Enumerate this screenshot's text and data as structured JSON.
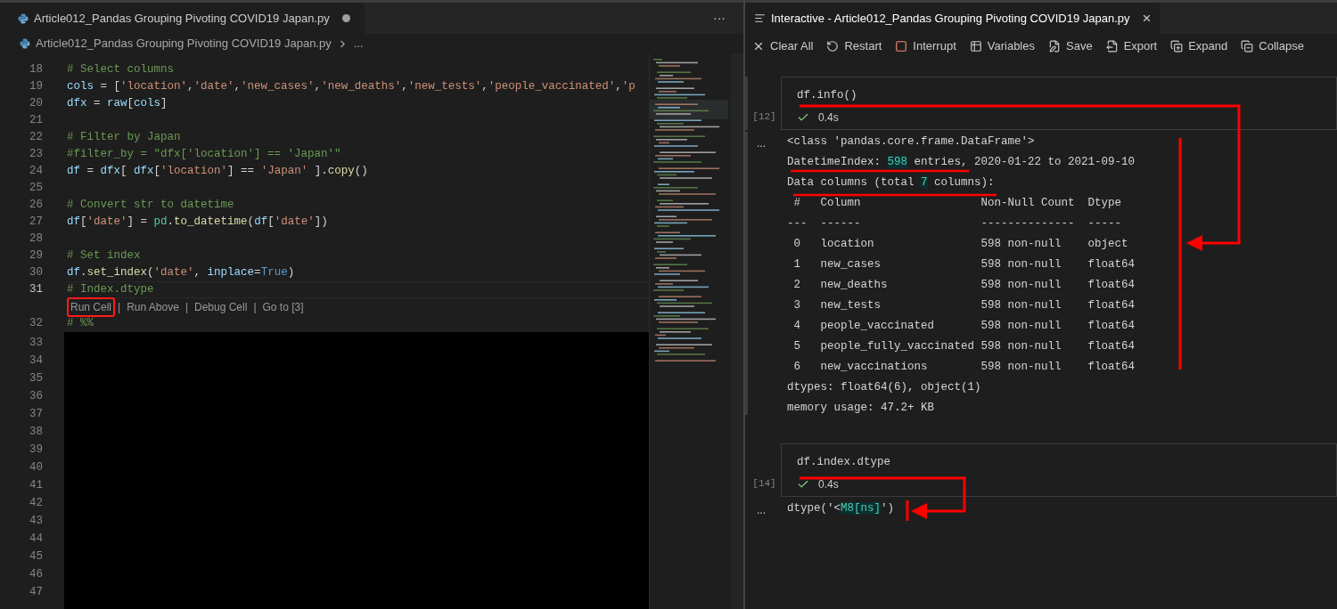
{
  "editor": {
    "tab": {
      "title": "Article012_Pandas Grouping Pivoting COVID19 Japan.py",
      "dirty": true
    },
    "more_actions": "···",
    "breadcrumb": {
      "file": "Article012_Pandas Grouping Pivoting COVID19 Japan.py",
      "rest": "..."
    },
    "code_lines": [
      {
        "number": "18",
        "current": false,
        "tokens": [
          {
            "t": "# Select columns",
            "kind": "comment"
          }
        ]
      },
      {
        "number": "19",
        "current": false,
        "tokens": [
          {
            "t": "cols",
            "kind": "variable"
          },
          {
            "t": " = [",
            "kind": "plain"
          },
          {
            "t": "'location'",
            "kind": "string"
          },
          {
            "t": ",",
            "kind": "plain"
          },
          {
            "t": "'date'",
            "kind": "string"
          },
          {
            "t": ",",
            "kind": "plain"
          },
          {
            "t": "'new_cases'",
            "kind": "string"
          },
          {
            "t": ",",
            "kind": "plain"
          },
          {
            "t": "'new_deaths'",
            "kind": "string"
          },
          {
            "t": ",",
            "kind": "plain"
          },
          {
            "t": "'new_tests'",
            "kind": "string"
          },
          {
            "t": ",",
            "kind": "plain"
          },
          {
            "t": "'people_vaccinated'",
            "kind": "string"
          },
          {
            "t": ",",
            "kind": "plain"
          },
          {
            "t": "'p",
            "kind": "string"
          }
        ]
      },
      {
        "number": "20",
        "current": false,
        "tokens": [
          {
            "t": "dfx",
            "kind": "variable"
          },
          {
            "t": " = ",
            "kind": "plain"
          },
          {
            "t": "raw",
            "kind": "variable"
          },
          {
            "t": "[",
            "kind": "plain"
          },
          {
            "t": "cols",
            "kind": "variable"
          },
          {
            "t": "]",
            "kind": "plain"
          }
        ]
      },
      {
        "number": "21",
        "current": false
      },
      {
        "number": "22",
        "current": false,
        "tokens": [
          {
            "t": "# Filter by Japan",
            "kind": "comment"
          }
        ]
      },
      {
        "number": "23",
        "current": false,
        "tokens": [
          {
            "t": "#filter_by = \"dfx['location'] == 'Japan'\"",
            "kind": "comment"
          }
        ]
      },
      {
        "number": "24",
        "current": false,
        "tokens": [
          {
            "t": "df",
            "kind": "variable"
          },
          {
            "t": " = ",
            "kind": "plain"
          },
          {
            "t": "dfx",
            "kind": "variable"
          },
          {
            "t": "[ ",
            "kind": "plain"
          },
          {
            "t": "dfx",
            "kind": "variable"
          },
          {
            "t": "[",
            "kind": "plain"
          },
          {
            "t": "'location'",
            "kind": "string"
          },
          {
            "t": "] == ",
            "kind": "plain"
          },
          {
            "t": "'Japan'",
            "kind": "string"
          },
          {
            "t": " ].",
            "kind": "plain"
          },
          {
            "t": "copy",
            "kind": "function"
          },
          {
            "t": "()",
            "kind": "plain"
          }
        ]
      },
      {
        "number": "25",
        "current": false
      },
      {
        "number": "26",
        "current": false,
        "tokens": [
          {
            "t": "# Convert str to datetime",
            "kind": "comment"
          }
        ]
      },
      {
        "number": "27",
        "current": false,
        "tokens": [
          {
            "t": "df",
            "kind": "variable"
          },
          {
            "t": "[",
            "kind": "plain"
          },
          {
            "t": "'date'",
            "kind": "string"
          },
          {
            "t": "] = ",
            "kind": "plain"
          },
          {
            "t": "pd",
            "kind": "module"
          },
          {
            "t": ".",
            "kind": "plain"
          },
          {
            "t": "to_datetime",
            "kind": "function"
          },
          {
            "t": "(",
            "kind": "plain"
          },
          {
            "t": "df",
            "kind": "variable"
          },
          {
            "t": "[",
            "kind": "plain"
          },
          {
            "t": "'date'",
            "kind": "string"
          },
          {
            "t": "])",
            "kind": "plain"
          }
        ]
      },
      {
        "number": "28",
        "current": false
      },
      {
        "number": "29",
        "current": false,
        "tokens": [
          {
            "t": "# Set index",
            "kind": "comment"
          }
        ]
      },
      {
        "number": "30",
        "current": false,
        "tokens": [
          {
            "t": "df",
            "kind": "variable"
          },
          {
            "t": ".",
            "kind": "plain"
          },
          {
            "t": "set_index",
            "kind": "function"
          },
          {
            "t": "(",
            "kind": "plain"
          },
          {
            "t": "'date'",
            "kind": "string"
          },
          {
            "t": ", ",
            "kind": "plain"
          },
          {
            "t": "inplace",
            "kind": "variable"
          },
          {
            "t": "=",
            "kind": "plain"
          },
          {
            "t": "True",
            "kind": "keyword"
          },
          {
            "t": ")",
            "kind": "plain"
          }
        ]
      },
      {
        "number": "31",
        "current": true,
        "tokens": [
          {
            "t": "# Index.dtype",
            "kind": "comment"
          }
        ]
      }
    ],
    "codelens": {
      "separator": "|",
      "items": [
        {
          "label": "Run Cell",
          "highlighted": true
        },
        {
          "label": "Run Above",
          "highlighted": false
        },
        {
          "label": "Debug Cell",
          "highlighted": false
        },
        {
          "label": "Go to [3]",
          "highlighted": false
        }
      ]
    },
    "after_lens_lines": [
      {
        "number": "32",
        "tokens": [
          {
            "t": "# %%",
            "kind": "comment"
          }
        ]
      }
    ],
    "blank_lines": [
      "33",
      "34",
      "35",
      "36",
      "37",
      "38",
      "39",
      "40",
      "41",
      "42",
      "43",
      "44",
      "45",
      "46",
      "47"
    ]
  },
  "interactive": {
    "tab": {
      "title": "Interactive - Article012_Pandas Grouping Pivoting COVID19 Japan.py",
      "close": "×"
    },
    "toolbar": [
      "Clear All",
      "Restart",
      "Interrupt",
      "Variables",
      "Save",
      "Export",
      "Expand",
      "Collapse"
    ],
    "cells": [
      {
        "selected": true,
        "code": "df.info()",
        "count": "[12]",
        "succeeded": true,
        "duration": "0.4s",
        "output_marker": "...",
        "output": [
          [
            {
              "t": "<class 'pandas.core.frame.DataFrame'>",
              "kind": "plain"
            }
          ],
          [
            {
              "t": "DatetimeIndex: ",
              "kind": "plain"
            },
            {
              "t": "598",
              "kind": "number"
            },
            {
              "t": " entries, 2020-01-22 to 2021-09-10",
              "kind": "plain"
            }
          ],
          [
            {
              "t": "Data columns (total ",
              "kind": "plain"
            },
            {
              "t": "7",
              "kind": "number"
            },
            {
              "t": " columns):",
              "kind": "plain"
            }
          ],
          [
            {
              "t": " #   Column                  Non-Null Count  Dtype",
              "kind": "plain"
            }
          ],
          [
            {
              "t": "---  ------                  --------------  -----",
              "kind": "plain"
            }
          ],
          [
            {
              "t": " 0   location                598 non-null    object",
              "kind": "plain"
            }
          ],
          [
            {
              "t": " 1   new_cases               598 non-null    float64",
              "kind": "plain"
            }
          ],
          [
            {
              "t": " 2   new_deaths              598 non-null    float64",
              "kind": "plain"
            }
          ],
          [
            {
              "t": " 3   new_tests               598 non-null    float64",
              "kind": "plain"
            }
          ],
          [
            {
              "t": " 4   people_vaccinated       598 non-null    float64",
              "kind": "plain"
            }
          ],
          [
            {
              "t": " 5   people_fully_vaccinated 598 non-null    float64",
              "kind": "plain"
            }
          ],
          [
            {
              "t": " 6   new_vaccinations        598 non-null    float64",
              "kind": "plain"
            }
          ],
          [
            {
              "t": "dtypes: float64(6), object(1)",
              "kind": "plain"
            }
          ],
          [
            {
              "t": "memory usage: 47.2+ KB",
              "kind": "plain"
            }
          ]
        ]
      },
      {
        "selected": false,
        "code": "df.index.dtype",
        "count": "[14]",
        "succeeded": true,
        "duration": "0.4s",
        "output_marker": "...",
        "output": [
          [
            {
              "t": "dtype('<",
              "kind": "plain"
            },
            {
              "t": "M8[ns]",
              "kind": "number"
            },
            {
              "t": "')",
              "kind": "plain"
            }
          ]
        ]
      }
    ]
  }
}
